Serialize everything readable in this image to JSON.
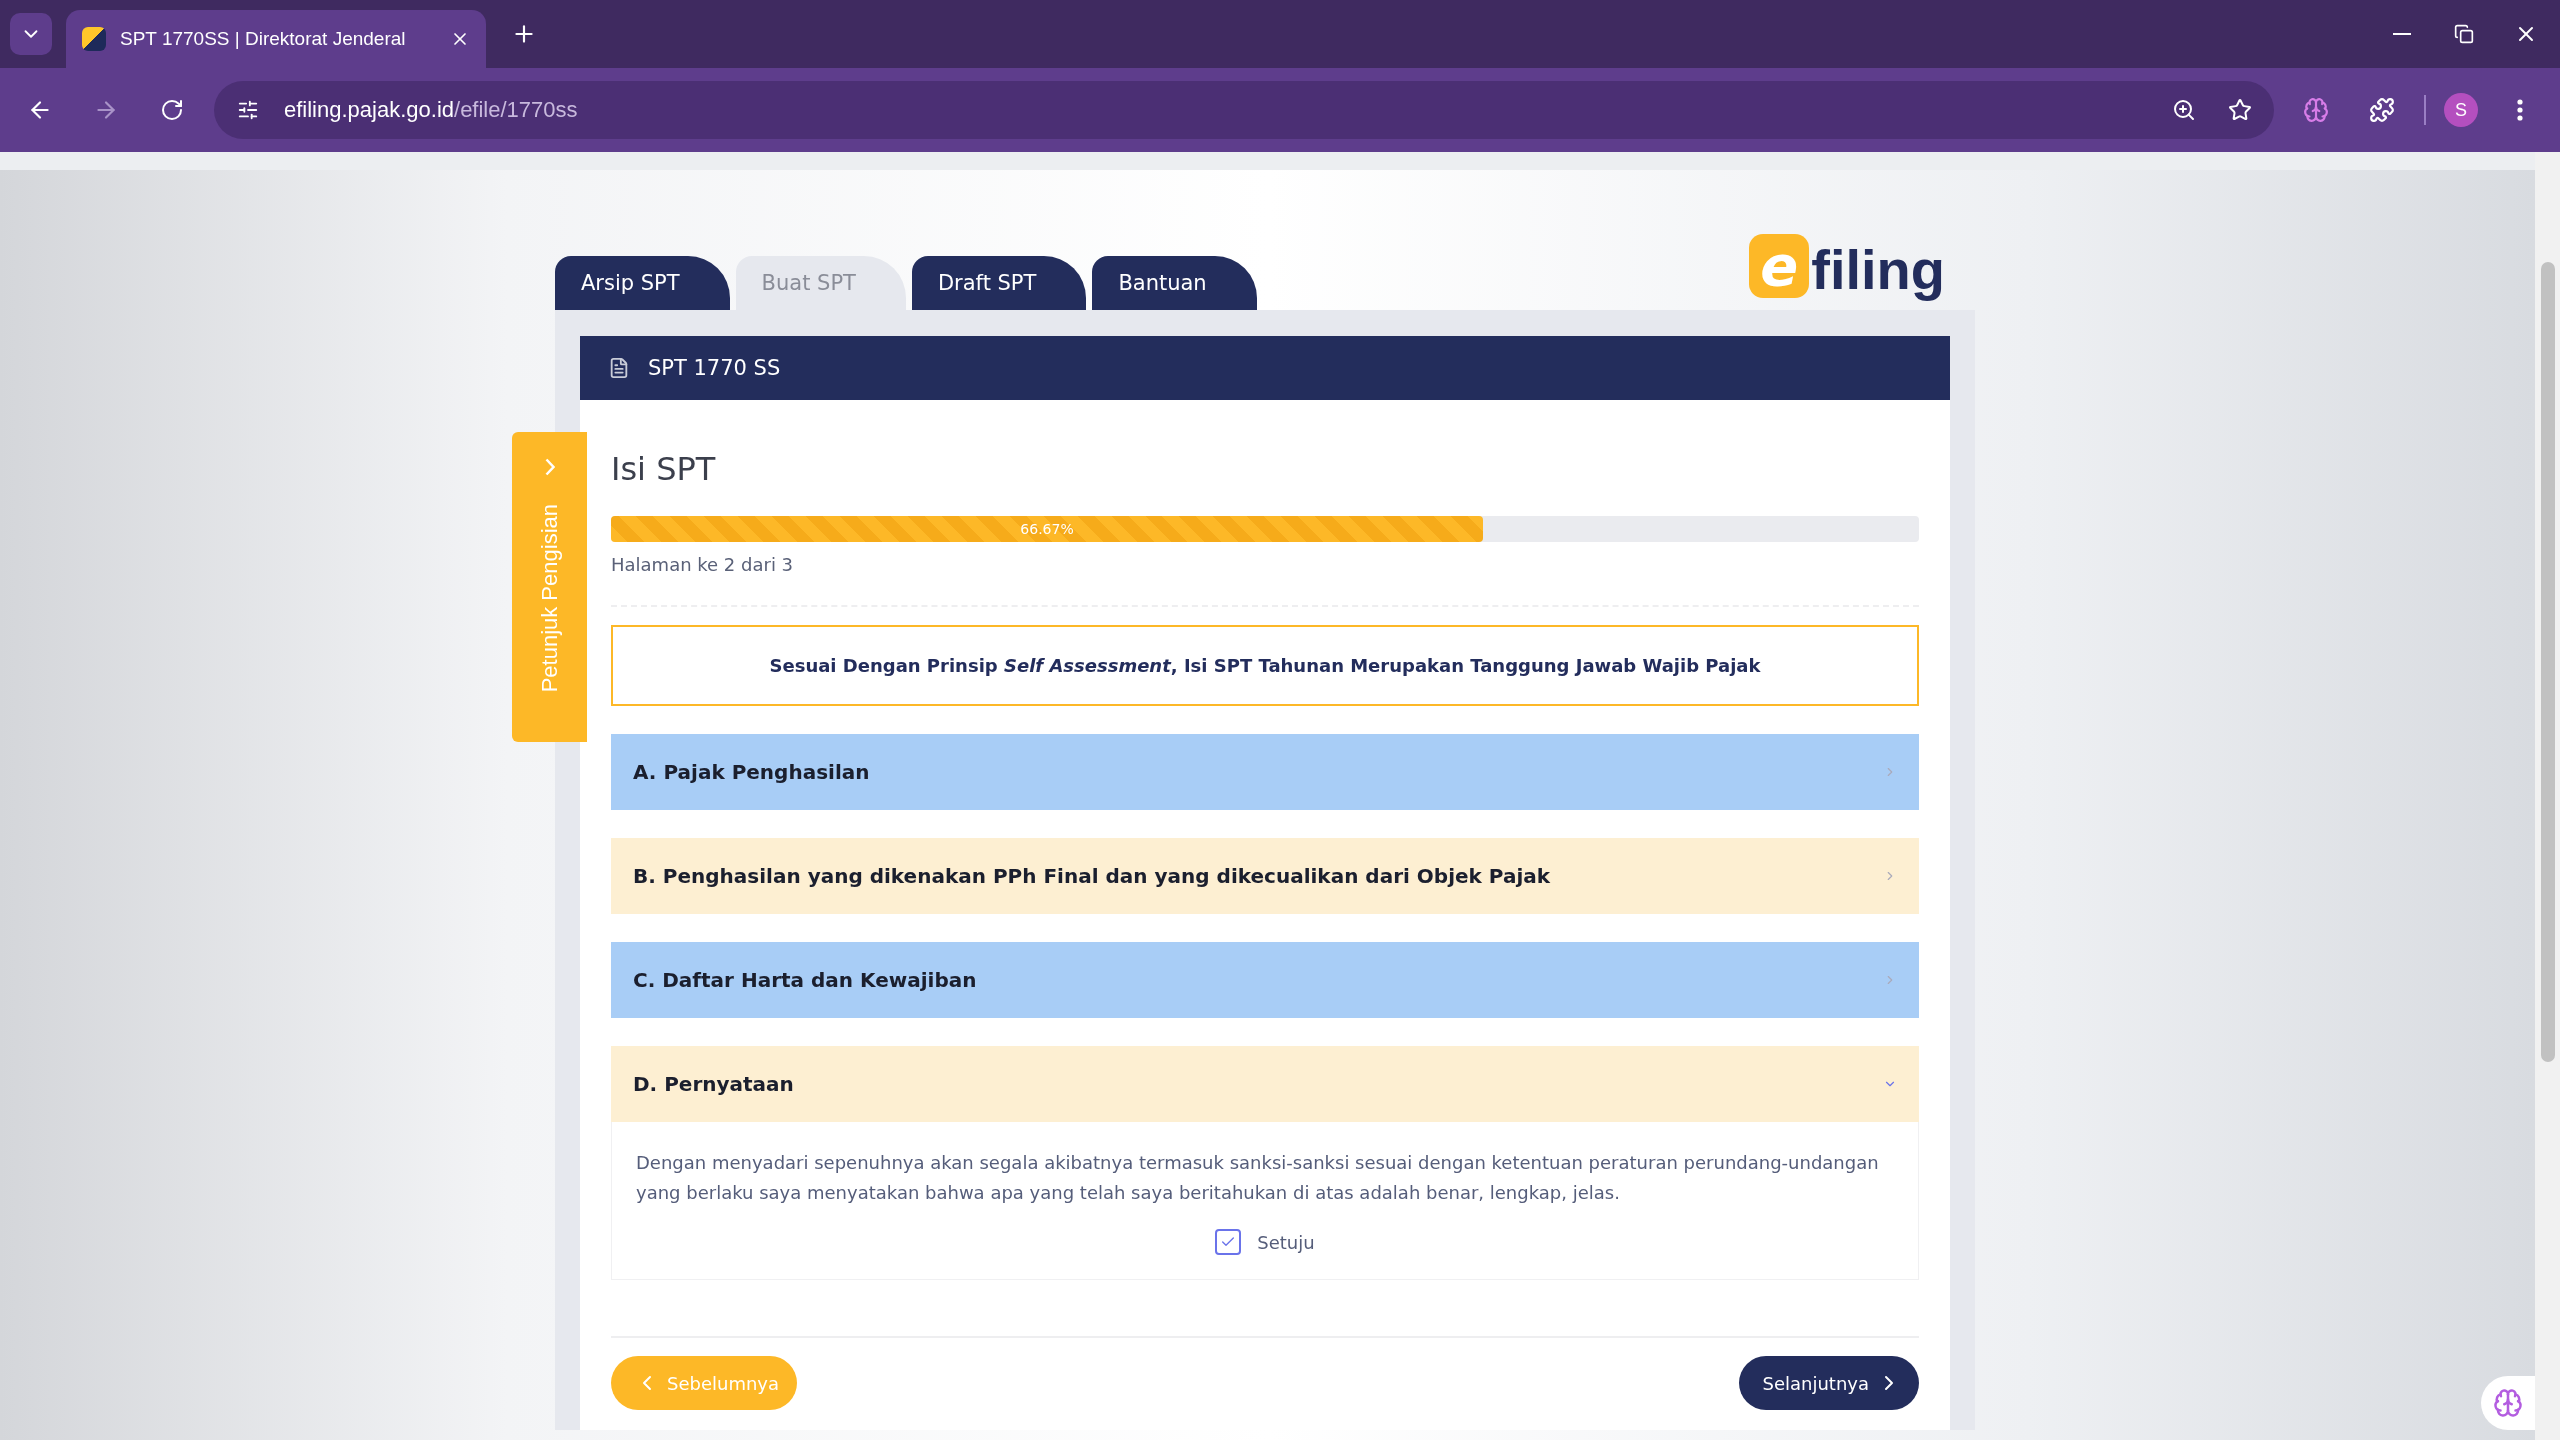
{
  "browser": {
    "tab_title": "SPT 1770SS | Direktorat Jenderal",
    "url_domain": "efiling.pajak.go.id",
    "url_path": "/efile/1770ss",
    "profile_initial": "S"
  },
  "nav_tabs": [
    {
      "label": "Arsip SPT",
      "selected": false
    },
    {
      "label": "Buat SPT",
      "selected": true
    },
    {
      "label": "Draft SPT",
      "selected": false
    },
    {
      "label": "Bantuan",
      "selected": false
    }
  ],
  "logo": {
    "mark": "e",
    "text": "filing"
  },
  "side_tab": {
    "label": "Petunjuk Pengisian"
  },
  "panel": {
    "title": "SPT 1770 SS"
  },
  "heading": "Isi SPT",
  "progress": {
    "level": 0.6667,
    "label": "66.67%"
  },
  "page_info": "Halaman ke 2 dari 3",
  "notice": "Sesuai Dengan Prinsip *Self Assessment*, Isi SPT Tahunan Merupakan Tanggung Jawab Wajib Pajak",
  "sections": [
    {
      "title": "A. Pajak Penghasilan",
      "color": "#a8cdf6",
      "expanded": false
    },
    {
      "title": "B. Penghasilan yang dikenakan PPh Final dan yang dikecualikan dari Objek Pajak",
      "color": "#fdefd2",
      "expanded": false
    },
    {
      "title": "C. Daftar Harta dan Kewajiban",
      "color": "#a8cdf6",
      "expanded": false
    },
    {
      "title": "D. Pernyataan",
      "color": "#fdefd2",
      "expanded": true,
      "body": "Dengan menyadari sepenuhnya akan segala akibatnya termasuk sanksi-sanksi sesuai dengan ketentuan peraturan perundang-undangan yang berlaku saya menyatakan bahwa apa yang telah saya beritahukan di atas adalah benar, lengkap, jelas.",
      "agree": {
        "label": "Setuju",
        "checked": true
      }
    }
  ],
  "buttons": {
    "previous": "Sebelumnya",
    "next": "Selanjutnya"
  }
}
